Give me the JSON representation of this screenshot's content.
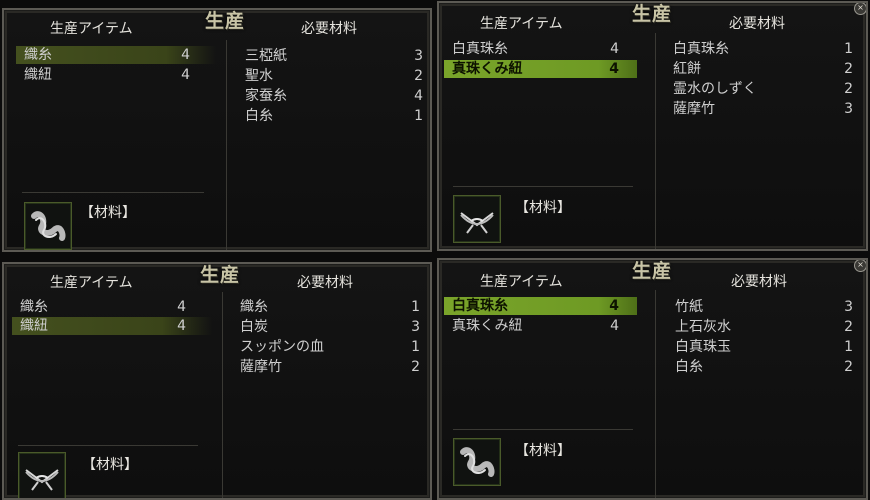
{
  "panels": [
    {
      "title": "生産",
      "item_header": "生産アイテム",
      "mat_header": "必要材料",
      "items": [
        {
          "name": "織糸",
          "qty": "4"
        },
        {
          "name": "織紐",
          "qty": "4"
        }
      ],
      "materials": [
        {
          "name": "三椏紙",
          "qty": "3"
        },
        {
          "name": "聖水",
          "qty": "2"
        },
        {
          "name": "家蚕糸",
          "qty": "4"
        },
        {
          "name": "白糸",
          "qty": "1"
        }
      ],
      "category": "【材料】",
      "icon": "thread-skein-icon"
    },
    {
      "title": "生産",
      "item_header": "生産アイテム",
      "mat_header": "必要材料",
      "items": [
        {
          "name": "白真珠糸",
          "qty": "4"
        },
        {
          "name": "真珠くみ紐",
          "qty": "4"
        }
      ],
      "materials": [
        {
          "name": "白真珠糸",
          "qty": "1"
        },
        {
          "name": "紅餅",
          "qty": "2"
        },
        {
          "name": "霊水のしずく",
          "qty": "2"
        },
        {
          "name": "薩摩竹",
          "qty": "3"
        }
      ],
      "category": "【材料】",
      "icon": "braided-cord-icon"
    },
    {
      "title": "生産",
      "item_header": "生産アイテム",
      "mat_header": "必要材料",
      "items": [
        {
          "name": "織糸",
          "qty": "4"
        },
        {
          "name": "織紐",
          "qty": "4"
        }
      ],
      "materials": [
        {
          "name": "織糸",
          "qty": "1"
        },
        {
          "name": "白炭",
          "qty": "3"
        },
        {
          "name": "スッポンの血",
          "qty": "1"
        },
        {
          "name": "薩摩竹",
          "qty": "2"
        }
      ],
      "category": "【材料】",
      "icon": "braided-cord-icon"
    },
    {
      "title": "生産",
      "item_header": "生産アイテム",
      "mat_header": "必要材料",
      "items": [
        {
          "name": "白真珠糸",
          "qty": "4"
        },
        {
          "name": "真珠くみ紐",
          "qty": "4"
        }
      ],
      "materials": [
        {
          "name": "竹紙",
          "qty": "3"
        },
        {
          "name": "上石灰水",
          "qty": "2"
        },
        {
          "name": "白真珠玉",
          "qty": "1"
        },
        {
          "name": "白糸",
          "qty": "2"
        }
      ],
      "category": "【材料】",
      "icon": "thread-skein-icon"
    }
  ],
  "close_glyph": "×"
}
